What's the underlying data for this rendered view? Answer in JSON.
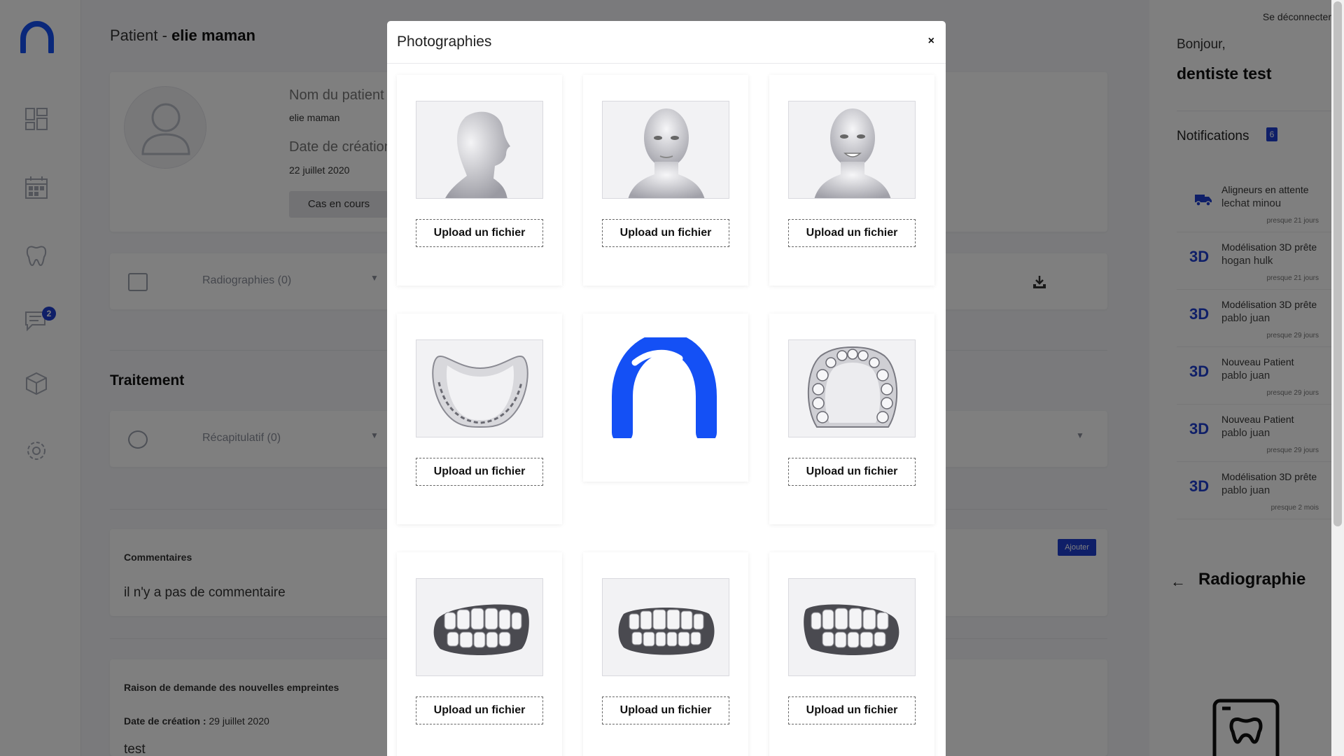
{
  "nav": {
    "messages_badge": "2"
  },
  "patient": {
    "title_prefix": "Patient - ",
    "name_title": "elie maman",
    "name_label": "Nom du patient",
    "name_value": "elie maman",
    "date_label": "Date de création",
    "date_value": "22 juillet 2020",
    "status_button": "Cas en cours"
  },
  "radiographies": {
    "label": "Radiographies (0)"
  },
  "treatment": {
    "section_title": "Traitement",
    "summary_label": "Récapitulatif (0)"
  },
  "comments": {
    "title": "Commentaires",
    "add_button": "Ajouter",
    "empty_text": "il n'y a pas de commentaire"
  },
  "reason": {
    "title": "Raison de demande des nouvelles empreintes",
    "date_label": "Date de création :",
    "date_value": " 29 juillet 2020",
    "text": "test"
  },
  "right_panel": {
    "logout": "Se déconnecter",
    "greeting": "Bonjour,",
    "user_name": "dentiste test",
    "notifications_title": "Notifications",
    "notifications_count": "6",
    "notifications": [
      {
        "icon": "truck-icon",
        "title": "Aligneurs en attente",
        "patient": "lechat minou",
        "time": "presque 21 jours"
      },
      {
        "icon": "3d-icon",
        "icon_text": "3D",
        "title": "Modélisation 3D prête",
        "patient": "hogan hulk",
        "time": "presque 21 jours"
      },
      {
        "icon": "3d-icon",
        "icon_text": "3D",
        "title": "Modélisation 3D prête",
        "patient": "pablo juan",
        "time": "presque 29 jours"
      },
      {
        "icon": "3d-icon",
        "icon_text": "3D",
        "title": "Nouveau Patient",
        "patient": "pablo juan",
        "time": "presque 29 jours"
      },
      {
        "icon": "3d-icon",
        "icon_text": "3D",
        "title": "Nouveau Patient",
        "patient": "pablo juan",
        "time": "presque 29 jours"
      },
      {
        "icon": "3d-icon",
        "icon_text": "3D",
        "title": "Modélisation 3D prête",
        "patient": "pablo juan",
        "time": "presque 2 mois"
      }
    ],
    "radiography_back": "←",
    "radiography_title": "Radiographie"
  },
  "modal": {
    "title": "Photographies",
    "close": "×",
    "upload_label": "Upload un fichier",
    "photos": [
      {
        "icon": "face-profile-image"
      },
      {
        "icon": "face-front-image"
      },
      {
        "icon": "face-smile-image"
      },
      {
        "icon": "lower-arch-image"
      },
      {
        "icon": "brand-logo"
      },
      {
        "icon": "upper-arch-image"
      },
      {
        "icon": "teeth-right-image"
      },
      {
        "icon": "teeth-front-image"
      },
      {
        "icon": "teeth-left-image"
      }
    ]
  },
  "colors": {
    "accent": "#1e3fd1",
    "logo_blue": "#1450f5",
    "overlay": "rgba(0,0,0,0.5)"
  }
}
